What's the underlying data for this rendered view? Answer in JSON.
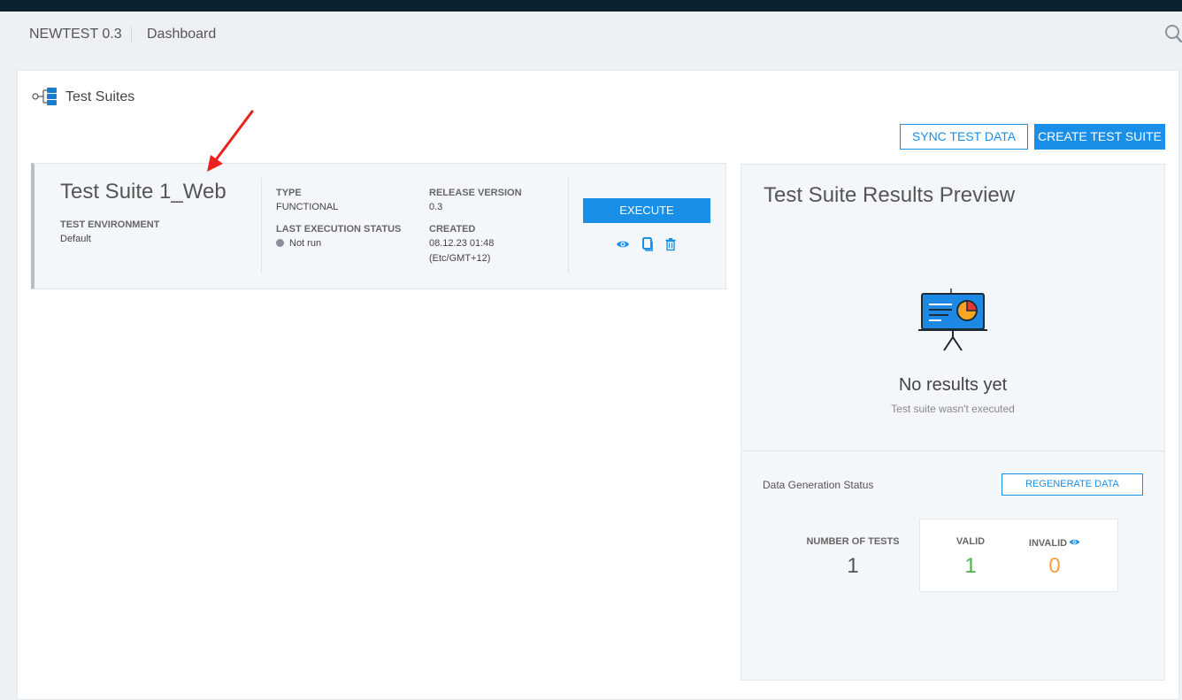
{
  "breadcrumb": {
    "project": "NEWTEST 0.3",
    "page": "Dashboard"
  },
  "section": {
    "title": "Test Suites"
  },
  "toolbar": {
    "sync_label": "SYNC TEST DATA",
    "create_label": "CREATE TEST SUITE"
  },
  "suite": {
    "name": "Test Suite 1_Web",
    "environment_label": "TEST ENVIRONMENT",
    "environment_value": "Default",
    "type_label": "TYPE",
    "type_value": "FUNCTIONAL",
    "last_status_label": "LAST EXECUTION STATUS",
    "last_status_value": "Not run",
    "release_label": "RELEASE VERSION",
    "release_value": "0.3",
    "created_label": "CREATED",
    "created_date": "08.12.23 01:48",
    "created_tz": "(Etc/GMT+12)",
    "execute_label": "EXECUTE"
  },
  "preview": {
    "title": "Test Suite Results Preview",
    "empty_title": "No results yet",
    "empty_subtitle": "Test suite wasn't executed",
    "data_gen_label": "Data Generation Status",
    "regenerate_label": "REGENERATE DATA",
    "number_of_tests_label": "NUMBER OF TESTS",
    "number_of_tests_value": "1",
    "valid_label": "VALID",
    "valid_value": "1",
    "invalid_label": "INVALID",
    "invalid_value": "0"
  },
  "colors": {
    "accent": "#1a8fe8",
    "topbar": "#0c2231",
    "valid": "#4caf50",
    "invalid": "#f5a043",
    "annotation_arrow": "#e8231f"
  },
  "icons": [
    "search-icon",
    "tree-structure-icon",
    "eye-icon",
    "copy-icon",
    "trash-icon",
    "presentation-chart-icon"
  ]
}
